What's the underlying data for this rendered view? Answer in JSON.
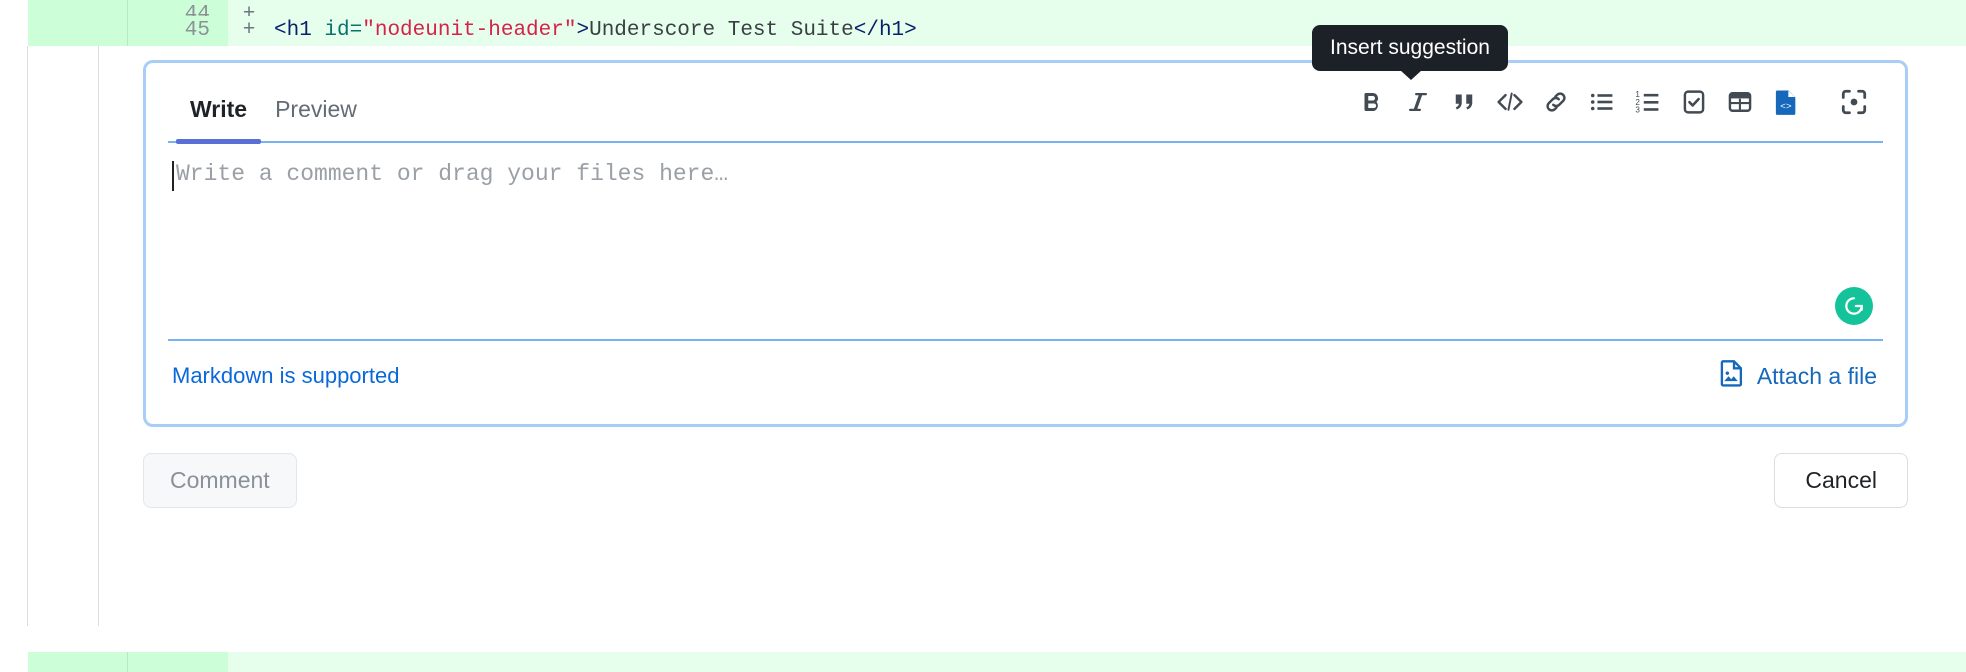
{
  "diff": {
    "rows": [
      {
        "lineno_old": "",
        "lineno_new": "44",
        "marker": "+",
        "segments": []
      },
      {
        "lineno_old": "",
        "lineno_new": "45",
        "marker": "+",
        "code_tag_open": "<h1 ",
        "code_attr": "id=",
        "code_value": "\"nodeunit-header\"",
        "code_gt": ">",
        "code_text": "Underscore Test Suite",
        "code_tag_close": "</h1>"
      }
    ],
    "added_bg": "#e6ffec",
    "gutter_bg": "#ccffd8"
  },
  "comment_form": {
    "tabs": [
      {
        "label": "Write",
        "active": true
      },
      {
        "label": "Preview",
        "active": false
      }
    ],
    "toolbar": [
      {
        "name": "bold",
        "label": "Bold"
      },
      {
        "name": "italic",
        "label": "Italic"
      },
      {
        "name": "quote",
        "label": "Quote"
      },
      {
        "name": "code",
        "label": "Code"
      },
      {
        "name": "link",
        "label": "Link"
      },
      {
        "name": "unordered-list",
        "label": "Unordered list"
      },
      {
        "name": "ordered-list",
        "label": "Ordered list"
      },
      {
        "name": "task-list",
        "label": "Task list"
      },
      {
        "name": "table",
        "label": "Table"
      },
      {
        "name": "insert-suggestion",
        "label": "Insert suggestion",
        "active": true
      },
      {
        "name": "reference",
        "label": "Reference"
      }
    ],
    "tooltip": "Insert suggestion",
    "editor": {
      "placeholder": "Write a comment or drag your files here…",
      "value": ""
    },
    "grammarly_letter": "G",
    "markdown_link": "Markdown is supported",
    "attach_label": "Attach a file"
  },
  "actions": {
    "submit_label": "Comment",
    "cancel_label": "Cancel"
  },
  "colors": {
    "focus_ring": "#a8cdf7",
    "link_blue": "#0969da",
    "accent_underline": "#5a6fd6",
    "grammarly_green": "#15c39a",
    "tooltip_bg": "#1c2128"
  }
}
